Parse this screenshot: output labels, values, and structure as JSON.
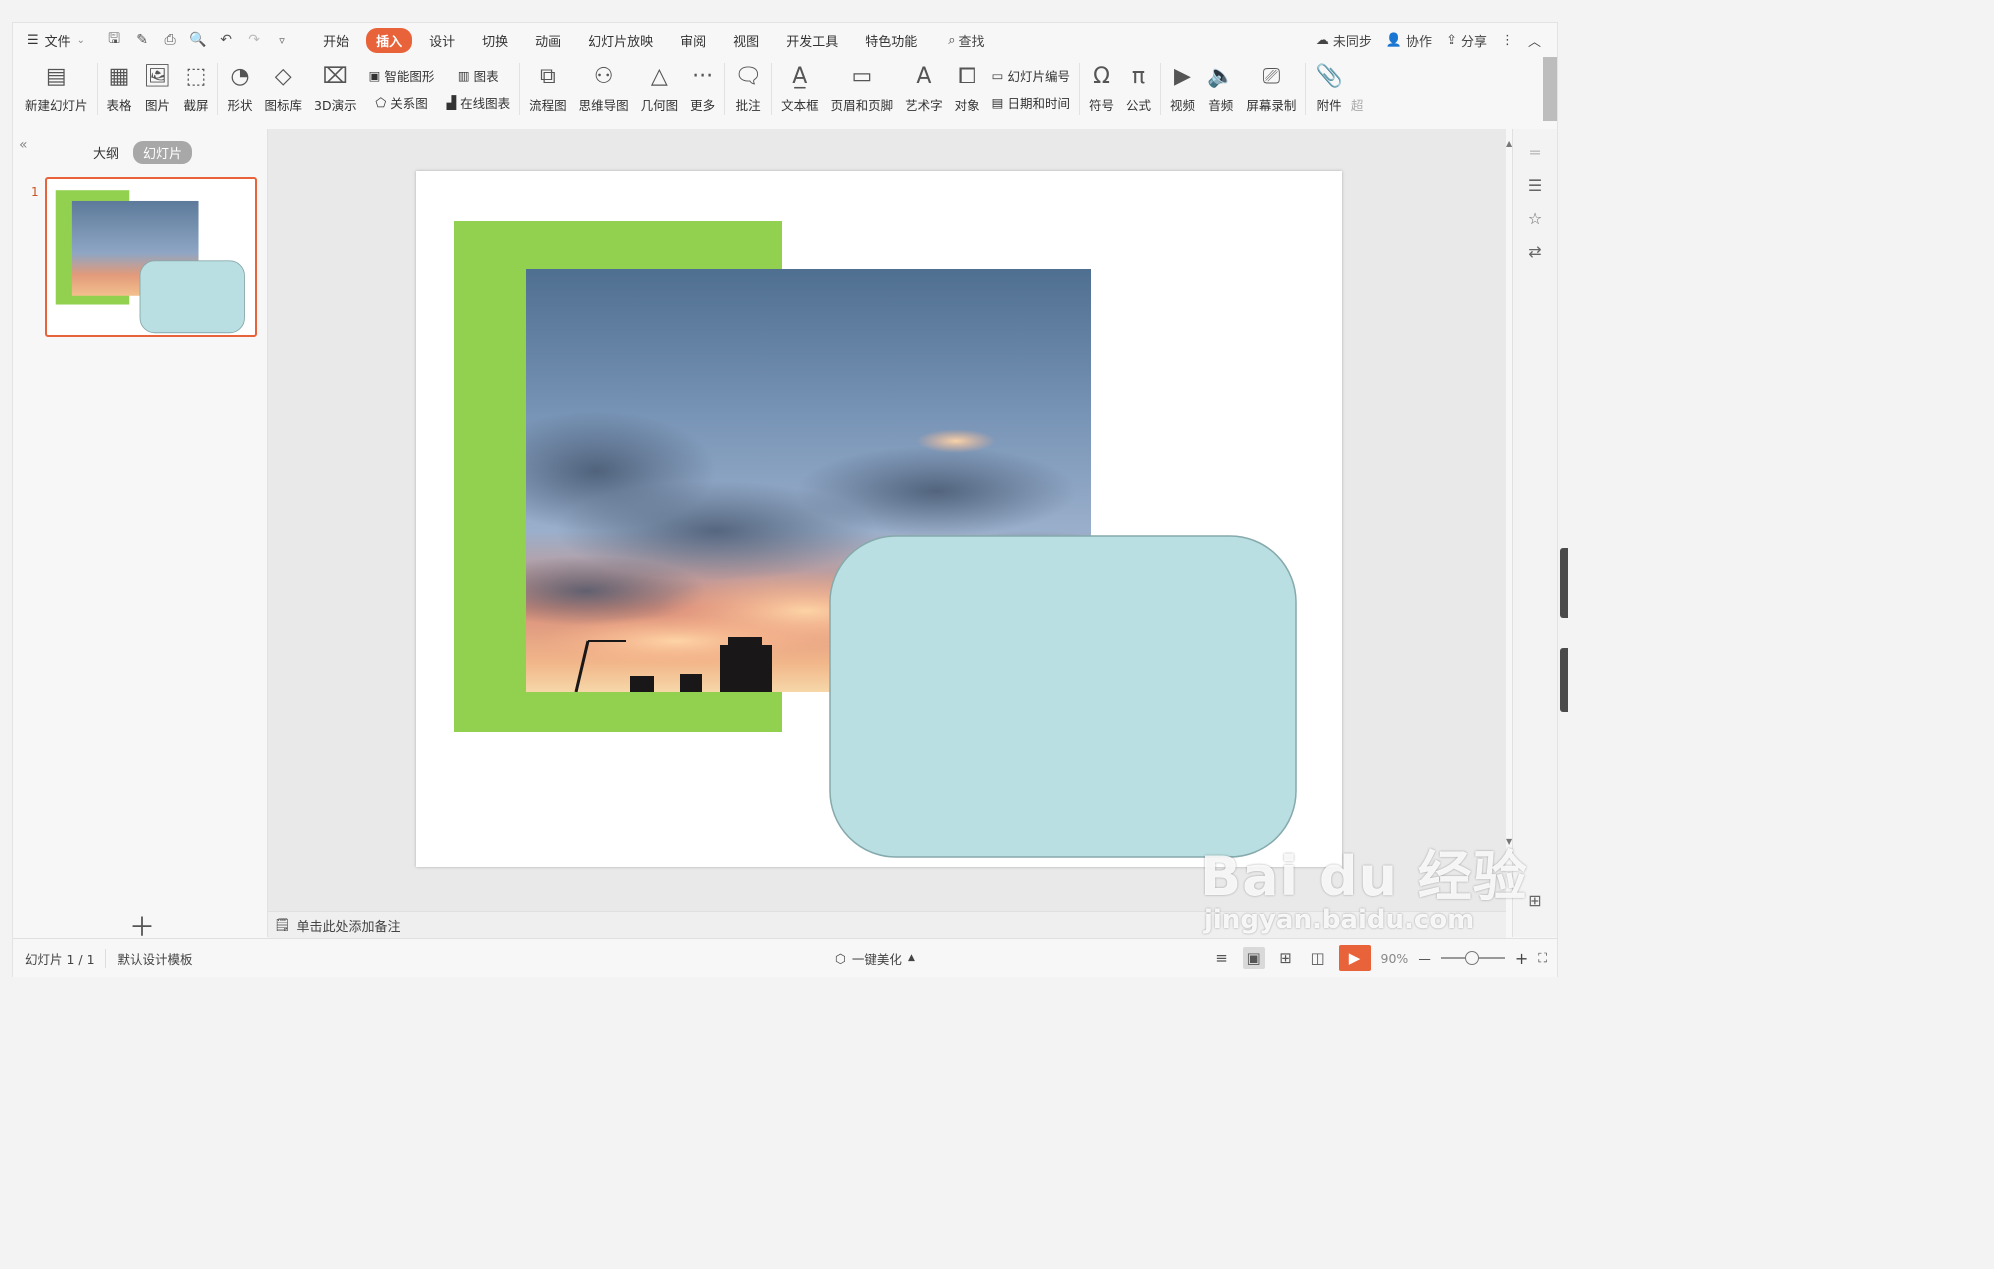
{
  "menubar": {
    "file_label": "文件",
    "tabs": [
      "开始",
      "插入",
      "设计",
      "切换",
      "动画",
      "幻灯片放映",
      "审阅",
      "视图",
      "开发工具",
      "特色功能"
    ],
    "active_tab": "插入",
    "search_label": "查找",
    "right": {
      "sync": "未同步",
      "collab": "协作",
      "share": "分享"
    }
  },
  "ribbon": {
    "new_slide": "新建幻灯片",
    "table": "表格",
    "picture": "图片",
    "screenshot": "截屏",
    "shape": "形状",
    "icon_lib": "图标库",
    "demo3d": "3D演示",
    "smart_shape": "智能图形",
    "relation": "关系图",
    "chart": "图表",
    "online_chart": "在线图表",
    "flowchart": "流程图",
    "mindmap": "思维导图",
    "geometry": "几何图",
    "more": "更多",
    "comment": "批注",
    "textbox": "文本框",
    "header_footer": "页眉和页脚",
    "wordart": "艺术字",
    "object": "对象",
    "slide_number": "幻灯片编号",
    "datetime": "日期和时间",
    "symbol": "符号",
    "formula": "公式",
    "video": "视频",
    "audio": "音频",
    "screen_record": "屏幕录制",
    "attachment": "附件",
    "overflow": "超"
  },
  "leftpanel": {
    "tab_outline": "大纲",
    "tab_slides": "幻灯片",
    "slide_number": "1"
  },
  "slide": {
    "colors": {
      "green": "#92d050",
      "rounded_box": "#b9dfe2",
      "rounded_box_border": "#86a9ac"
    }
  },
  "notes": {
    "placeholder": "单击此处添加备注"
  },
  "statusbar": {
    "slide_info": "幻灯片 1 / 1",
    "template": "默认设计模板",
    "beautify": "一键美化",
    "zoom": "90%"
  },
  "watermark": {
    "brand": "Bai du 经验",
    "url": "jingyan.baidu.com"
  }
}
